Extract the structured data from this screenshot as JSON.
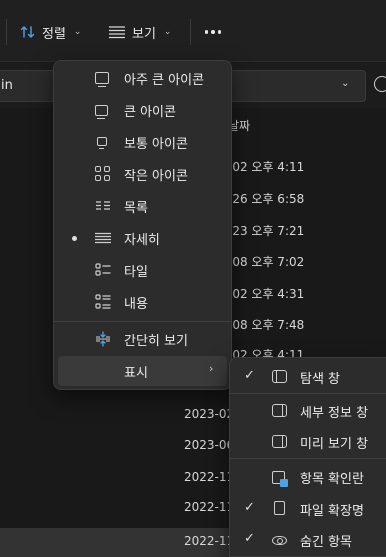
{
  "toolbar": {
    "sort_label": "정렬",
    "view_label": "보기"
  },
  "address": {
    "path_fragment": "in"
  },
  "file_list": {
    "header_fragment": "날짜",
    "partial_dates": [
      "-02 오후 4:11",
      "-26 오후 6:58",
      "-23 오후 7:21",
      "-08 오후 7:02",
      "-02 오후 4:31",
      "-08 오후 7:48",
      "-02 오후 4:11"
    ],
    "visible_dates": [
      "2023-02",
      "2023-06",
      "2022-11",
      "2022-11",
      "2022-11"
    ]
  },
  "view_menu": {
    "items": [
      {
        "label": "아주 큰 아이콘",
        "icon": "extra-large-icons-icon",
        "selected": false
      },
      {
        "label": "큰 아이콘",
        "icon": "large-icons-icon",
        "selected": false
      },
      {
        "label": "보통 아이콘",
        "icon": "medium-icons-icon",
        "selected": false
      },
      {
        "label": "작은 아이콘",
        "icon": "small-icons-icon",
        "selected": false
      },
      {
        "label": "목록",
        "icon": "list-icon",
        "selected": false
      },
      {
        "label": "자세히",
        "icon": "details-icon",
        "selected": true
      },
      {
        "label": "타일",
        "icon": "tiles-icon",
        "selected": false
      },
      {
        "label": "내용",
        "icon": "content-icon",
        "selected": false
      },
      {
        "label": "간단히 보기",
        "icon": "compact-view-icon",
        "selected": false
      },
      {
        "label": "표시",
        "icon": "",
        "selected": false
      }
    ]
  },
  "show_submenu": {
    "items": [
      {
        "label": "탐색 창",
        "icon": "navigation-pane-icon",
        "checked": true
      },
      {
        "label": "세부 정보 창",
        "icon": "details-pane-icon",
        "checked": false
      },
      {
        "label": "미리 보기 창",
        "icon": "preview-pane-icon",
        "checked": false
      },
      {
        "label": "항목 확인란",
        "icon": "item-checkbox-icon",
        "checked": false
      },
      {
        "label": "파일 확장명",
        "icon": "file-extension-icon",
        "checked": true
      },
      {
        "label": "숨긴 항목",
        "icon": "hidden-items-icon",
        "checked": true
      }
    ],
    "check_glyph": "✓"
  }
}
